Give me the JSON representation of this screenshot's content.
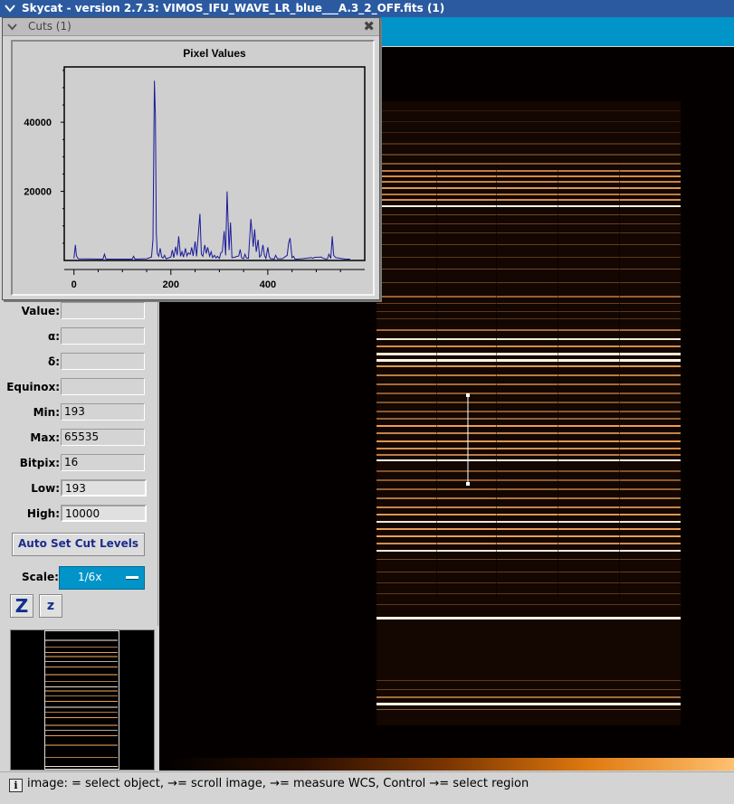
{
  "window": {
    "title": "Skycat - version 2.7.3: VIMOS_IFU_WAVE_LR_blue___A.3_2_OFF.fits (1)"
  },
  "cuts_window": {
    "title": "Cuts (1)",
    "close_glyph": "✖",
    "chart_data": {
      "type": "line",
      "title": "Pixel Values",
      "xlabel": "",
      "ylabel": "",
      "xlim": [
        -20,
        600
      ],
      "ylim": [
        0,
        56000
      ],
      "x_ticks": [
        0,
        200,
        400
      ],
      "y_ticks": [
        20000,
        40000
      ],
      "grid": false,
      "series": [
        {
          "color": "#1a1a9a",
          "x": [
            0,
            3,
            5,
            7,
            10,
            60,
            63,
            66,
            120,
            123,
            126,
            150,
            160,
            163,
            166,
            168,
            170,
            172,
            175,
            178,
            181,
            184,
            187,
            190,
            200,
            203,
            206,
            210,
            213,
            216,
            220,
            223,
            226,
            230,
            233,
            236,
            240,
            243,
            246,
            250,
            253,
            256,
            260,
            263,
            266,
            270,
            273,
            276,
            280,
            283,
            286,
            290,
            293,
            296,
            300,
            303,
            306,
            310,
            313,
            316,
            320,
            323,
            326,
            330,
            340,
            343,
            346,
            350,
            353,
            356,
            360,
            365,
            370,
            373,
            376,
            380,
            383,
            386,
            390,
            393,
            396,
            400,
            403,
            406,
            410,
            413,
            416,
            420,
            430,
            440,
            443,
            446,
            450,
            453,
            456,
            460,
            470,
            490,
            493,
            496,
            510,
            515,
            520,
            523,
            526,
            530,
            533,
            536,
            540,
            560,
            570
          ],
          "y": [
            600,
            4500,
            1500,
            800,
            500,
            400,
            1800,
            400,
            400,
            1200,
            400,
            500,
            1000,
            6000,
            52000,
            42000,
            8000,
            2000,
            1200,
            3500,
            1000,
            700,
            1500,
            500,
            1000,
            3000,
            800,
            4000,
            1500,
            7000,
            1200,
            2500,
            1000,
            3500,
            1300,
            2200,
            1800,
            3800,
            1300,
            5500,
            1200,
            6500,
            13500,
            1800,
            1200,
            4500,
            2000,
            3800,
            1200,
            2500,
            800,
            1500,
            700,
            1200,
            600,
            2200,
            2500,
            8500,
            1500,
            20000,
            3000,
            11000,
            800,
            900,
            1300,
            3200,
            700,
            500,
            1800,
            700,
            600,
            12000,
            4000,
            9000,
            2500,
            6000,
            1000,
            1500,
            4500,
            1500,
            600,
            3800,
            1100,
            500,
            500,
            400,
            1500,
            500,
            500,
            1500,
            5000,
            6500,
            800,
            1200,
            400,
            400,
            500,
            800,
            600,
            900,
            1000,
            600,
            400,
            500,
            1800,
            600,
            7000,
            1500,
            800,
            400,
            400
          ]
        }
      ]
    }
  },
  "info_panel": {
    "fields": [
      {
        "label": "Value:",
        "value": ""
      },
      {
        "label": "α:",
        "value": ""
      },
      {
        "label": "δ:",
        "value": ""
      },
      {
        "label": "Equinox:",
        "value": ""
      },
      {
        "label": "Min:",
        "value": "193"
      },
      {
        "label": "Max:",
        "value": "65535"
      },
      {
        "label": "Bitpix:",
        "value": "16"
      },
      {
        "label": "Low:",
        "value": "193"
      },
      {
        "label": "High:",
        "value": "10000"
      }
    ],
    "auto_set_label": "Auto Set Cut Levels",
    "scale_label": "Scale:",
    "scale_value": "1/6x",
    "zoom_in_label": "Z",
    "zoom_out_label": "z"
  },
  "status_bar": {
    "info_glyph": "i",
    "text": "image: = select object, →= scroll image, →= measure WCS, Control →= select region"
  },
  "colors": {
    "title_blue": "#2c5aa0",
    "accent_blue": "#0094c8",
    "plot_line": "#1a1a9a",
    "spectrum": "#ffb060"
  }
}
